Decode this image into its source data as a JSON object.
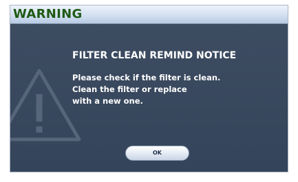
{
  "window": {
    "title": "WARNING"
  },
  "dialog": {
    "heading": "FILTER CLEAN REMIND NOTICE",
    "message_lines": [
      "Please check if the filter is clean.",
      "Clean the filter or replace",
      "with a new one."
    ],
    "ok_label": "OK",
    "watermark_icon": "warning-triangle-icon"
  },
  "colors": {
    "title_text": "#1f5a14",
    "titlebar": "#d2dff0",
    "body_background": "#3a495e",
    "text": "#ffffff",
    "button": "#e8eef6"
  }
}
